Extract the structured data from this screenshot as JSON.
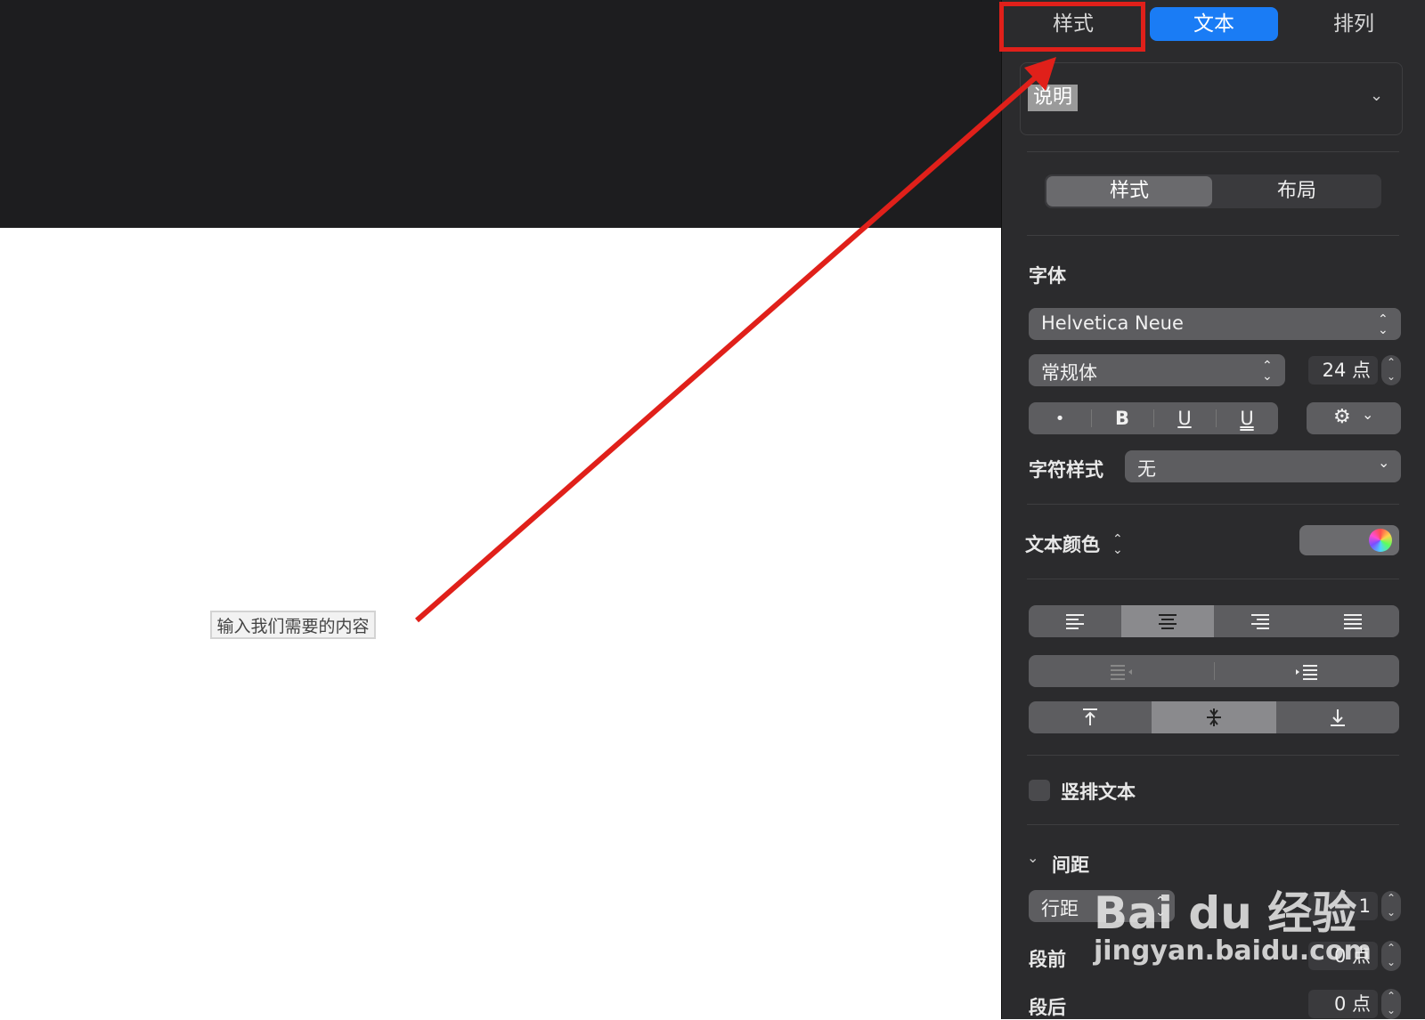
{
  "inspector_tabs": {
    "style": "样式",
    "text": "文本",
    "arrange": "排列"
  },
  "paragraph_style": {
    "name": "说明"
  },
  "subtabs": {
    "style": "样式",
    "layout": "布局"
  },
  "font": {
    "heading": "字体",
    "family": "Helvetica Neue",
    "typeface": "常规体",
    "size": "24 点",
    "bold_glyph": "B",
    "underline_glyph": "U",
    "strikeline_glyph": "U",
    "char_style_label": "字符样式",
    "char_style_value": "无"
  },
  "text_color": {
    "label": "文本颜色"
  },
  "vertical_text": {
    "label": "竖排文本",
    "checked": false
  },
  "spacing": {
    "heading": "间距",
    "line_label": "行距",
    "line_value": "1",
    "before_label": "段前",
    "before_value": "0 点",
    "after_label": "段后",
    "after_value": "0 点"
  },
  "canvas": {
    "textbox_text": "输入我们需要的内容"
  },
  "watermark": {
    "line1": "Bai du 经验",
    "line2": "jingyan.baidu.com"
  },
  "colors": {
    "active_tab": "#1a7cf5",
    "annotation": "#e0201a",
    "panel": "#2b2b2d"
  }
}
